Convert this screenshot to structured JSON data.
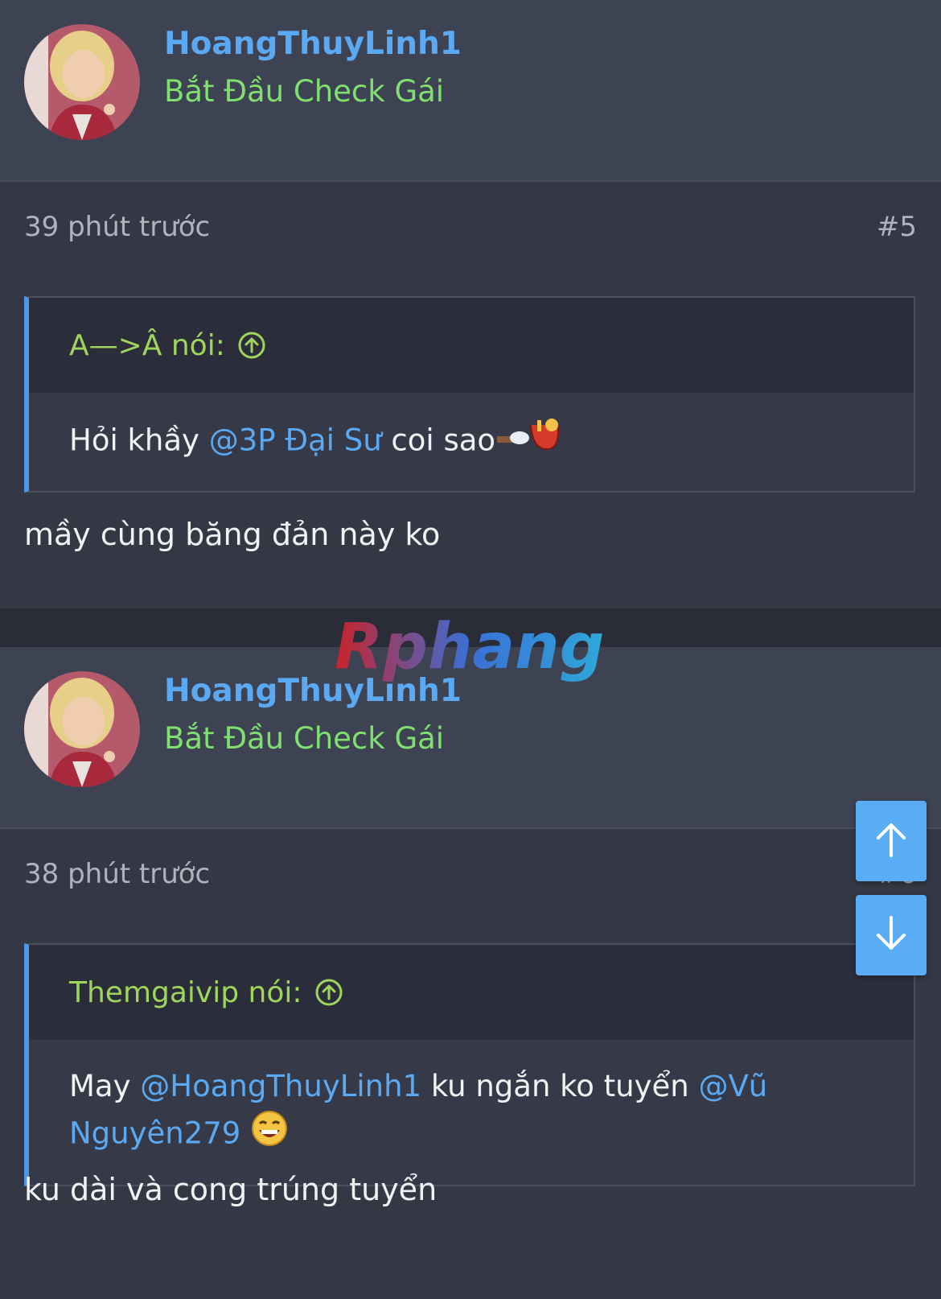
{
  "posts": [
    {
      "username": "HoangThuyLinh1",
      "user_title": "Bắt Đầu Check Gái",
      "timestamp": "39 phút trước",
      "post_number": "#5",
      "quote": {
        "author": "A—>Â nói:",
        "text_before": "Hỏi khầy ",
        "mention": "@3P Đại Sư",
        "text_after": " coi sao"
      },
      "message": "mầy cùng băng đản này ko"
    },
    {
      "username": "HoangThuyLinh1",
      "user_title": "Bắt Đầu Check Gái",
      "timestamp": "38 phút trước",
      "post_number": "#6",
      "quote": {
        "author": "Themgaivip nói:",
        "text_before": "May ",
        "mention1": "@HoangThuyLinh1",
        "text_middle": " ku ngắn ko tuyển ",
        "mention2": "@Vũ Nguyên279"
      },
      "message": "ku dài và cong trúng tuyển"
    }
  ],
  "watermark": "Rphang",
  "icons": {
    "quote_jump": "arrow-up-circle-icon",
    "scroll_up": "arrow-up-icon",
    "scroll_down": "arrow-down-icon"
  },
  "colors": {
    "username": "#5aa9f2",
    "user_title": "#7fe06f",
    "quote_author": "#9fd55d",
    "mention": "#5aa9f2",
    "scroll_button": "#5aacf5"
  }
}
